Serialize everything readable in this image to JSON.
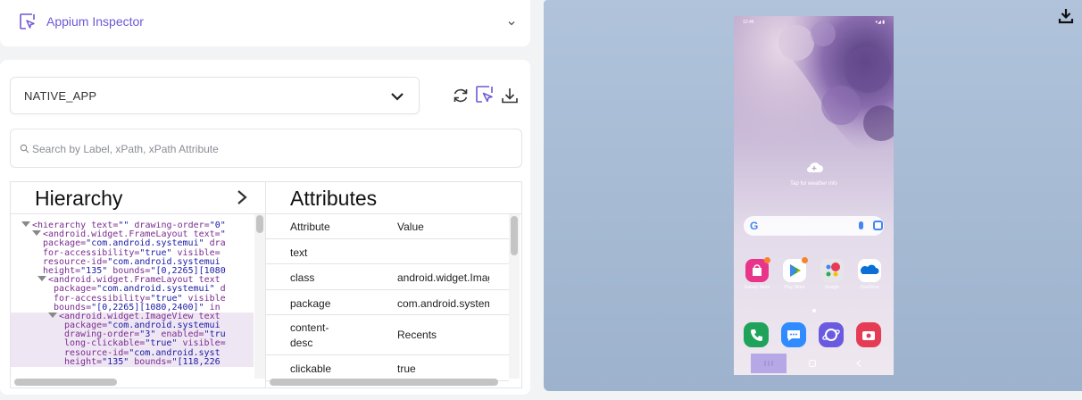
{
  "header": {
    "title": "Appium Inspector"
  },
  "app_selector": {
    "value": "NATIVE_APP"
  },
  "search": {
    "placeholder": "Search by Label, xPath, xPath Attribute"
  },
  "hierarchy": {
    "title": "Hierarchy",
    "lines": [
      {
        "indent": 2,
        "tri": true,
        "segs": [
          [
            "tag",
            "<hierarchy "
          ],
          [
            "attr",
            "text="
          ],
          [
            "val",
            "\"\""
          ],
          [
            "attr",
            " drawing-order="
          ],
          [
            "val",
            "\"0\""
          ]
        ]
      },
      {
        "indent": 4,
        "tri": true,
        "segs": [
          [
            "tag",
            "<android.widget.FrameLayout "
          ],
          [
            "attr",
            "text="
          ],
          [
            "val",
            "\""
          ]
        ]
      },
      {
        "indent": 6,
        "tri": false,
        "segs": [
          [
            "attr",
            "package="
          ],
          [
            "val",
            "\"com.android.systemui\""
          ],
          [
            "attr",
            " dra"
          ]
        ]
      },
      {
        "indent": 6,
        "tri": false,
        "segs": [
          [
            "attr",
            "for-accessibility="
          ],
          [
            "val",
            "\"true\""
          ],
          [
            "attr",
            " visible="
          ]
        ]
      },
      {
        "indent": 6,
        "tri": false,
        "segs": [
          [
            "attr",
            "resource-id="
          ],
          [
            "val",
            "\"com.android.systemui"
          ]
        ]
      },
      {
        "indent": 6,
        "tri": false,
        "segs": [
          [
            "attr",
            "height="
          ],
          [
            "val",
            "\"135\""
          ],
          [
            "attr",
            " bounds="
          ],
          [
            "val",
            "\"[0,2265][1080"
          ]
        ]
      },
      {
        "indent": 5,
        "tri": true,
        "segs": [
          [
            "tag",
            "<android.widget.FrameLayout "
          ],
          [
            "attr",
            "text"
          ]
        ]
      },
      {
        "indent": 8,
        "tri": false,
        "segs": [
          [
            "attr",
            "package="
          ],
          [
            "val",
            "\"com.android.systemui\""
          ],
          [
            "attr",
            " d"
          ]
        ]
      },
      {
        "indent": 8,
        "tri": false,
        "segs": [
          [
            "attr",
            "for-accessibility="
          ],
          [
            "val",
            "\"true\""
          ],
          [
            "attr",
            " visible"
          ]
        ]
      },
      {
        "indent": 8,
        "tri": false,
        "segs": [
          [
            "attr",
            "bounds="
          ],
          [
            "val",
            "\"[0,2265][1080,2400]\""
          ],
          [
            "attr",
            " in"
          ]
        ]
      },
      {
        "indent": 7,
        "tri": true,
        "sel": true,
        "segs": [
          [
            "tag",
            "<android.widget.ImageView "
          ],
          [
            "attr",
            "text"
          ]
        ]
      },
      {
        "indent": 10,
        "tri": false,
        "sel": true,
        "segs": [
          [
            "attr",
            "package="
          ],
          [
            "val",
            "\"com.android.systemui"
          ]
        ]
      },
      {
        "indent": 10,
        "tri": false,
        "sel": true,
        "segs": [
          [
            "attr",
            "drawing-order="
          ],
          [
            "val",
            "\"3\""
          ],
          [
            "attr",
            " enabled="
          ],
          [
            "val",
            "\"tru"
          ]
        ]
      },
      {
        "indent": 10,
        "tri": false,
        "sel": true,
        "segs": [
          [
            "attr",
            "long-clickable="
          ],
          [
            "val",
            "\"true\""
          ],
          [
            "attr",
            " visible="
          ]
        ]
      },
      {
        "indent": 10,
        "tri": false,
        "sel": true,
        "segs": [
          [
            "attr",
            "resource-id="
          ],
          [
            "val",
            "\"com.android.syst"
          ]
        ]
      },
      {
        "indent": 10,
        "tri": false,
        "sel": true,
        "segs": [
          [
            "attr",
            "height="
          ],
          [
            "val",
            "\"135\""
          ],
          [
            "attr",
            " bounds="
          ],
          [
            "val",
            "\"[118,226"
          ]
        ]
      }
    ]
  },
  "attributes": {
    "title": "Attributes",
    "col_attribute": "Attribute",
    "col_value": "Value",
    "rows": [
      {
        "key": "text",
        "value": ""
      },
      {
        "key": "class",
        "value": "android.widget.ImageView"
      },
      {
        "key": "package",
        "value": "com.android.systemui"
      },
      {
        "key": "content-desc",
        "value": "Recents"
      },
      {
        "key": "clickable",
        "value": "true"
      }
    ]
  },
  "device": {
    "time": "12:46",
    "weather_text": "Tap for weather info",
    "search_logo": "G",
    "apps": [
      {
        "label": "Galaxy Store",
        "color": "#e8358a",
        "badge": true
      },
      {
        "label": "Play Store",
        "color": "#ffffff",
        "badge": true
      },
      {
        "label": "Google",
        "color": "#e6e6ea",
        "badge": false
      },
      {
        "label": "OneDrive",
        "color": "#ffffff",
        "badge": false
      }
    ],
    "dock": [
      {
        "name": "phone",
        "color": "#1fa35b"
      },
      {
        "name": "messages",
        "color": "#2f8bff"
      },
      {
        "name": "internet",
        "color": "#6a5ae0"
      },
      {
        "name": "camera",
        "color": "#e63b55"
      }
    ]
  },
  "colors": {
    "accent": "#6f58d6"
  }
}
